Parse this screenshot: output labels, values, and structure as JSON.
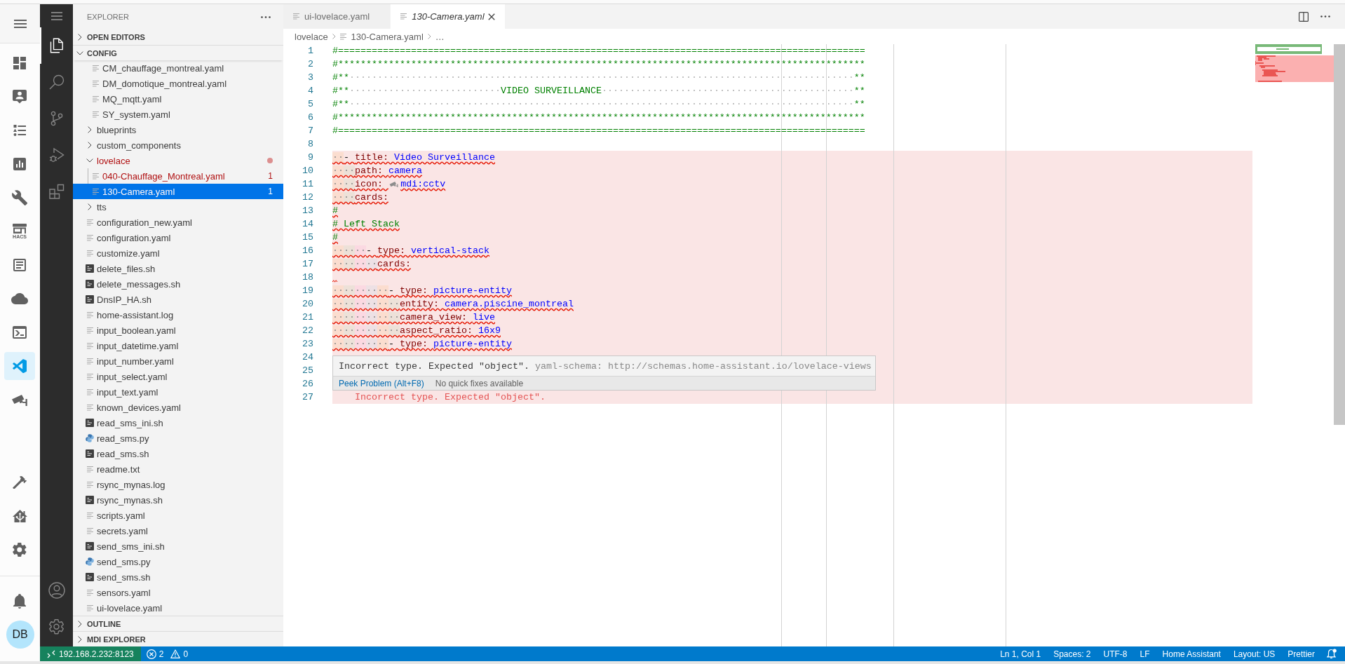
{
  "ha_sidebar": {
    "items": [
      {
        "selected": false
      },
      {
        "selected": false
      },
      {
        "selected": false
      },
      {
        "selected": false
      },
      {
        "selected": false
      },
      {
        "selected": false,
        "caption": "HACS"
      },
      {
        "selected": false
      },
      {
        "selected": false
      },
      {
        "selected": false
      },
      {
        "selected": true
      },
      {
        "selected": false
      }
    ],
    "bottom_items": [
      {
        "selected": false
      },
      {
        "selected": false
      },
      {
        "selected": false
      }
    ],
    "avatar": "DB"
  },
  "activity_bar": {
    "items": [
      {
        "selected": true
      },
      {
        "selected": false
      },
      {
        "selected": false
      },
      {
        "selected": false
      },
      {
        "selected": false
      }
    ]
  },
  "explorer": {
    "title": "EXPLORER",
    "sections": [
      {
        "label": "OPEN EDITORS",
        "expanded": false
      },
      {
        "label": "CONFIG",
        "expanded": true,
        "tree": [
          {
            "children": [
              {
                "label": "CM_chauffage_montreal.yaml",
                "kind": "text",
                "selected": false,
                "error": false
              },
              {
                "label": "DM_domotique_montreal.yaml",
                "kind": "text",
                "selected": false,
                "error": false
              },
              {
                "label": "MQ_mqtt.yaml",
                "kind": "text",
                "selected": false,
                "error": false
              },
              {
                "label": "SY_system.yaml",
                "kind": "text",
                "selected": false,
                "error": false
              }
            ]
          },
          {
            "label": "blueprints",
            "kind": "folder",
            "expanded": false,
            "selected": false,
            "error": false
          },
          {
            "label": "custom_components",
            "kind": "folder",
            "expanded": false,
            "selected": false,
            "error": false
          },
          {
            "label": "lovelace",
            "kind": "folder",
            "expanded": true,
            "selected": false,
            "error": true,
            "children": [
              {
                "label": "040-Chauffage_Montreal.yaml",
                "kind": "text",
                "selected": false,
                "error": true,
                "badge": "1"
              },
              {
                "label": "130-Camera.yaml",
                "kind": "text",
                "selected": true,
                "error": true,
                "badge": "1"
              }
            ]
          },
          {
            "label": "tts",
            "kind": "folder",
            "expanded": false,
            "selected": false,
            "error": false
          },
          {
            "label": "configuration_new.yaml",
            "kind": "text",
            "selected": false,
            "error": false
          },
          {
            "label": "configuration.yaml",
            "kind": "text",
            "selected": false,
            "error": false
          },
          {
            "label": "customize.yaml",
            "kind": "text",
            "selected": false,
            "error": false
          },
          {
            "label": "delete_files.sh",
            "kind": "shell",
            "selected": false,
            "error": false
          },
          {
            "label": "delete_messages.sh",
            "kind": "shell",
            "selected": false,
            "error": false
          },
          {
            "label": "DnsIP_HA.sh",
            "kind": "shell",
            "selected": false,
            "error": false
          },
          {
            "label": "home-assistant.log",
            "kind": "text",
            "selected": false,
            "error": false
          },
          {
            "label": "input_boolean.yaml",
            "kind": "text",
            "selected": false,
            "error": false
          },
          {
            "label": "input_datetime.yaml",
            "kind": "text",
            "selected": false,
            "error": false
          },
          {
            "label": "input_number.yaml",
            "kind": "text",
            "selected": false,
            "error": false
          },
          {
            "label": "input_select.yaml",
            "kind": "text",
            "selected": false,
            "error": false
          },
          {
            "label": "input_text.yaml",
            "kind": "text",
            "selected": false,
            "error": false
          },
          {
            "label": "known_devices.yaml",
            "kind": "text",
            "selected": false,
            "error": false
          },
          {
            "label": "read_sms_ini.sh",
            "kind": "shell",
            "selected": false,
            "error": false
          },
          {
            "label": "read_sms.py",
            "kind": "python",
            "selected": false,
            "error": false
          },
          {
            "label": "read_sms.sh",
            "kind": "shell",
            "selected": false,
            "error": false
          },
          {
            "label": "readme.txt",
            "kind": "text",
            "selected": false,
            "error": false
          },
          {
            "label": "rsync_mynas.log",
            "kind": "text",
            "selected": false,
            "error": false
          },
          {
            "label": "rsync_mynas.sh",
            "kind": "shell",
            "selected": false,
            "error": false
          },
          {
            "label": "scripts.yaml",
            "kind": "text",
            "selected": false,
            "error": false
          },
          {
            "label": "secrets.yaml",
            "kind": "text",
            "selected": false,
            "error": false
          },
          {
            "label": "send_sms_ini.sh",
            "kind": "shell",
            "selected": false,
            "error": false
          },
          {
            "label": "send_sms.py",
            "kind": "python",
            "selected": false,
            "error": false
          },
          {
            "label": "send_sms.sh",
            "kind": "shell",
            "selected": false,
            "error": false
          },
          {
            "label": "sensors.yaml",
            "kind": "text",
            "selected": false,
            "error": false
          },
          {
            "label": "ui-lovelace.yaml",
            "kind": "text",
            "selected": false,
            "error": false
          }
        ]
      },
      {
        "label": "OUTLINE",
        "expanded": false
      },
      {
        "label": "MDI EXPLORER",
        "expanded": false
      }
    ]
  },
  "editor": {
    "tabs": [
      {
        "label": "ui-lovelace.yaml",
        "selected": false,
        "preview": false
      },
      {
        "label": "130-Camera.yaml",
        "selected": true,
        "preview": true
      }
    ],
    "breadcrumbs": [
      {
        "kind": "folder",
        "label": "lovelace"
      },
      {
        "kind": "file",
        "label": "130-Camera.yaml"
      },
      {
        "kind": "more",
        "label": "…"
      }
    ],
    "lines": [
      {
        "number": "1",
        "error": false,
        "tokens": [
          {
            "kind": "comment",
            "text": "#=============================================================================================="
          }
        ]
      },
      {
        "number": "2",
        "error": false,
        "tokens": [
          {
            "kind": "comment",
            "text": "#**********************************************************************************************"
          }
        ]
      },
      {
        "number": "3",
        "error": false,
        "tokens": [
          {
            "kind": "comment",
            "text": "#**"
          },
          {
            "kind": "space",
            "text": "··························································································"
          },
          {
            "kind": "comment",
            "text": "**"
          }
        ]
      },
      {
        "number": "4",
        "error": false,
        "tokens": [
          {
            "kind": "comment",
            "text": "#**"
          },
          {
            "kind": "space",
            "text": "···························"
          },
          {
            "kind": "comment",
            "text": "VIDEO SURVEILLANCE"
          },
          {
            "kind": "space",
            "text": "·············································"
          },
          {
            "kind": "comment",
            "text": "**"
          }
        ]
      },
      {
        "number": "5",
        "error": false,
        "tokens": [
          {
            "kind": "comment",
            "text": "#**"
          },
          {
            "kind": "space",
            "text": "··························································································"
          },
          {
            "kind": "comment",
            "text": "**"
          }
        ]
      },
      {
        "number": "6",
        "error": false,
        "tokens": [
          {
            "kind": "comment",
            "text": "#**********************************************************************************************"
          }
        ]
      },
      {
        "number": "7",
        "error": false,
        "tokens": [
          {
            "kind": "comment",
            "text": "#=============================================================================================="
          }
        ]
      },
      {
        "number": "8",
        "error": false
      },
      {
        "number": "9",
        "error": true,
        "tokens": [
          {
            "kind": "indent",
            "text": "··"
          },
          {
            "kind": "dash",
            "text": "- "
          },
          {
            "kind": "key",
            "text": "title: "
          },
          {
            "kind": "value",
            "text": "Video Surveillance"
          }
        ]
      },
      {
        "number": "10",
        "error": true,
        "tokens": [
          {
            "kind": "indent",
            "text": "····"
          },
          {
            "kind": "key",
            "text": "path: "
          },
          {
            "kind": "value",
            "text": "camera"
          }
        ]
      },
      {
        "number": "11",
        "error": true,
        "tokens": [
          {
            "kind": "indent",
            "text": "····"
          },
          {
            "kind": "key",
            "text": "icon: "
          },
          {
            "kind": "icon_preview"
          },
          {
            "kind": "value",
            "text": "mdi:cctv"
          }
        ]
      },
      {
        "number": "12",
        "error": true,
        "tokens": [
          {
            "kind": "indent",
            "text": "····"
          },
          {
            "kind": "key",
            "text": "cards:"
          }
        ]
      },
      {
        "number": "13",
        "error": true,
        "tokens": [
          {
            "kind": "comment",
            "text": "#"
          }
        ]
      },
      {
        "number": "14",
        "error": true,
        "tokens": [
          {
            "kind": "comment",
            "text": "# Left Stack"
          }
        ]
      },
      {
        "number": "15",
        "error": true,
        "tokens": [
          {
            "kind": "comment",
            "text": "#"
          }
        ]
      },
      {
        "number": "16",
        "error": true,
        "tokens": [
          {
            "kind": "indent",
            "text": "······"
          },
          {
            "kind": "dash",
            "text": "- "
          },
          {
            "kind": "key",
            "text": "type: "
          },
          {
            "kind": "value",
            "text": "vertical-stack"
          }
        ]
      },
      {
        "number": "17",
        "error": true,
        "tokens": [
          {
            "kind": "indent",
            "text": "········"
          },
          {
            "kind": "key",
            "text": "cards:"
          }
        ]
      },
      {
        "number": "18",
        "error": true,
        "tokens": [
          {
            "kind": "squiggle"
          }
        ]
      },
      {
        "number": "19",
        "error": true,
        "tokens": [
          {
            "kind": "indent",
            "text": "··········"
          },
          {
            "kind": "dash",
            "text": "- "
          },
          {
            "kind": "key",
            "text": "type: "
          },
          {
            "kind": "value",
            "text": "picture-entity"
          }
        ]
      },
      {
        "number": "20",
        "error": true,
        "tokens": [
          {
            "kind": "indent",
            "text": "············"
          },
          {
            "kind": "key",
            "text": "entity: "
          },
          {
            "kind": "value",
            "text": "camera.piscine_montreal"
          }
        ]
      },
      {
        "number": "21",
        "error": true,
        "tokens": [
          {
            "kind": "indent",
            "text": "············"
          },
          {
            "kind": "key",
            "text": "camera_view: "
          },
          {
            "kind": "value",
            "text": "live"
          }
        ]
      },
      {
        "number": "22",
        "error": true,
        "tokens": [
          {
            "kind": "indent",
            "text": "············"
          },
          {
            "kind": "key",
            "text": "aspect_ratio: "
          },
          {
            "kind": "value",
            "text": "16x9"
          }
        ]
      },
      {
        "number": "23",
        "error": true,
        "tokens": [
          {
            "kind": "indent",
            "text": "··········"
          },
          {
            "kind": "dash",
            "text": "- "
          },
          {
            "kind": "key",
            "text": "type: "
          },
          {
            "kind": "value",
            "text": "picture-entity"
          }
        ]
      },
      {
        "number": "24",
        "error": true
      },
      {
        "number": "25",
        "error": true
      },
      {
        "number": "26",
        "error": true
      },
      {
        "number": "27",
        "error": true,
        "tokens": [
          {
            "kind": "error_message",
            "text": "Incorrect type. Expected \"object\"."
          }
        ]
      }
    ],
    "hover": {
      "message": "Incorrect type. Expected \"object\".",
      "source": "yaml-schema: http://schemas.home-assistant.io/lovelace-views",
      "action": "Peek Problem (Alt+F8)",
      "note": "No quick fixes available"
    }
  },
  "status_bar": {
    "remote": "192.168.2.232:8123",
    "errors": "2",
    "warnings": "0",
    "items": [
      "Ln 1, Col 1",
      "Spaces: 2",
      "UTF-8",
      "LF",
      "Home Assistant",
      "Layout: US",
      "Prettier"
    ]
  }
}
